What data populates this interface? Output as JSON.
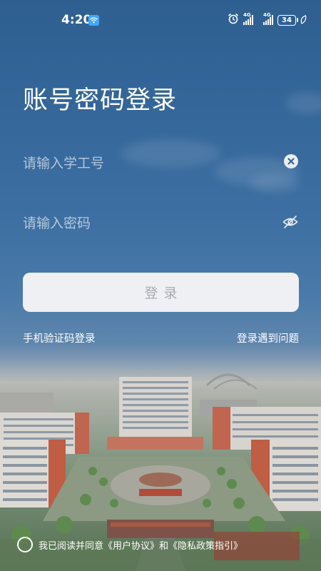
{
  "status_bar": {
    "time": "4:20",
    "network_1": "4G",
    "network_2": "4G",
    "battery": "34"
  },
  "page": {
    "title": "账号密码登录"
  },
  "account_field": {
    "placeholder": "请输入学工号",
    "value": ""
  },
  "password_field": {
    "placeholder": "请输入密码",
    "value": ""
  },
  "login_button": {
    "label": "登录"
  },
  "links": {
    "sms_login": "手机验证码登录",
    "login_problem": "登录遇到问题"
  },
  "agreement": {
    "prefix": "我已阅读并同意",
    "user_agreement": "《用户协议》",
    "conjunction": "和",
    "privacy_policy": "《隐私政策指引》",
    "checked": false
  },
  "icons": {
    "clear": "clear-icon",
    "visibility": "eye-off-icon",
    "wifi": "wifi-icon",
    "alarm": "alarm-icon",
    "battery": "battery-icon"
  },
  "colors": {
    "background_top": "#2f5f91",
    "button_bg": "#eef0f3",
    "button_text": "#a7abb2",
    "text": "#ffffff"
  }
}
